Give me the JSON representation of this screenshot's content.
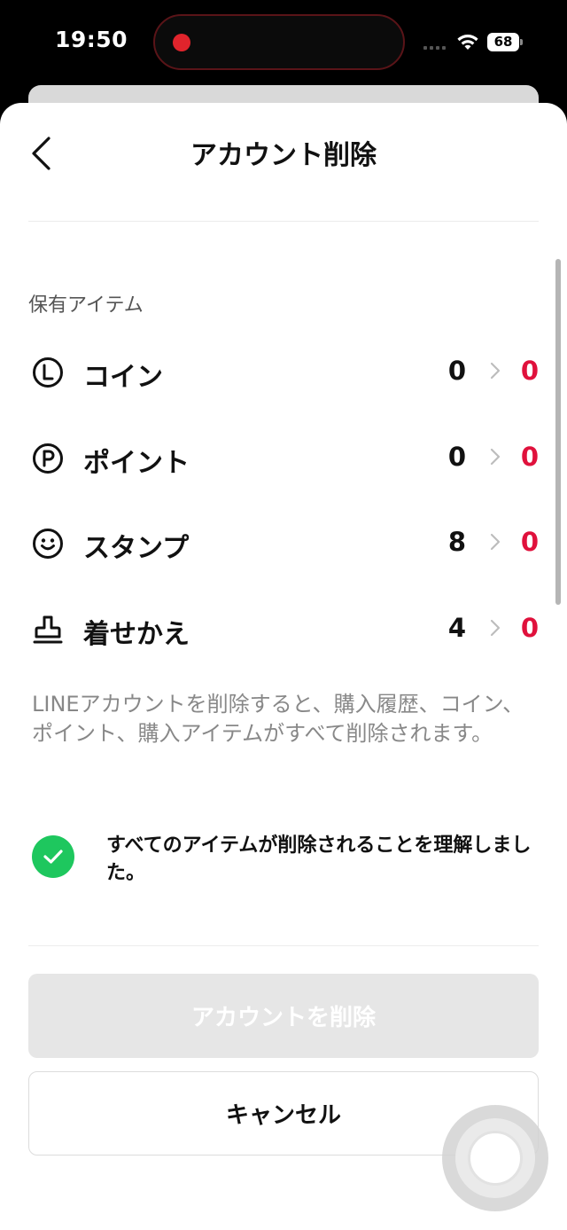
{
  "status_bar": {
    "time": "19:50",
    "battery": "68"
  },
  "header": {
    "title": "アカウント削除",
    "back_icon": "chevron-left-icon"
  },
  "items_section": {
    "label": "保有アイテム",
    "items": [
      {
        "label": "コイン",
        "icon": "coin-icon",
        "from": "0",
        "to": "0"
      },
      {
        "label": "ポイント",
        "icon": "point-icon",
        "from": "0",
        "to": "0"
      },
      {
        "label": "スタンプ",
        "icon": "smiley-icon",
        "from": "8",
        "to": "0"
      },
      {
        "label": "着せかえ",
        "icon": "stamp-icon",
        "from": "4",
        "to": "0"
      }
    ]
  },
  "notice": "LINEアカウントを削除すると、購入履歴、コイン、ポイント、購入アイテムがすべて削除されます。",
  "consent": {
    "label": "すべてのアイテムが削除されることを理解しました。",
    "checked": true
  },
  "buttons": {
    "delete_label": "アカウントを削除",
    "cancel_label": "キャンセル"
  },
  "colors": {
    "accent_red": "#e0113c",
    "check_green": "#1ec75e",
    "disabled_button": "#e6e6e6"
  }
}
